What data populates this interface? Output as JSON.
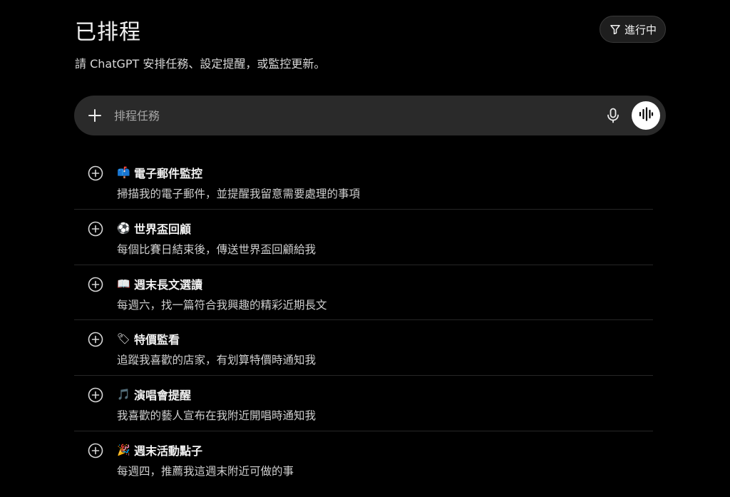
{
  "header": {
    "title": "已排程",
    "filter_label": "進行中",
    "filter_icon": "funnel-icon"
  },
  "subtitle": "請 ChatGPT 安排任務、設定提醒，或監控更新。",
  "composer": {
    "placeholder": "排程任務",
    "value": "",
    "add_icon": "plus-icon",
    "mic_icon": "microphone-icon",
    "voice_icon": "voice-waveform-icon"
  },
  "suggestions": [
    {
      "emoji": "📫",
      "icon": "mailbox-icon",
      "title": "電子郵件監控",
      "description": "掃描我的電子郵件，並提醒我留意需要處理的事項"
    },
    {
      "emoji": "⚽",
      "icon": "soccer-ball-icon",
      "title": "世界盃回顧",
      "description": "每個比賽日結束後，傳送世界盃回顧給我"
    },
    {
      "emoji": "📖",
      "icon": "open-book-icon",
      "title": "週末長文選讀",
      "description": "每週六，找一篇符合我興趣的精彩近期長文"
    },
    {
      "emoji": "🏷",
      "icon": "price-tag-icon",
      "title": "特價監看",
      "description": "追蹤我喜歡的店家，有划算特價時通知我"
    },
    {
      "emoji": "🎵",
      "icon": "music-note-icon",
      "title": "演唱會提醒",
      "description": "我喜歡的藝人宣布在我附近開唱時通知我"
    },
    {
      "emoji": "🎉",
      "icon": "party-popper-icon",
      "title": "週末活動點子",
      "description": "每週四，推薦我這週末附近可做的事"
    }
  ],
  "colors": {
    "background": "#000000",
    "composer": "#2a2a2a",
    "text_primary": "#f2f2f2",
    "text_secondary": "#cfcfcf"
  }
}
